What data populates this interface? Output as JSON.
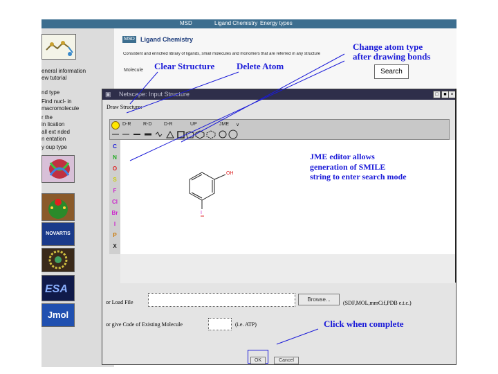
{
  "nav": {
    "msd": "MSD",
    "ligand": "Ligand Chemistry",
    "energy": "Energy types"
  },
  "sidebar": {
    "lines": [
      "eneral information",
      "ew tutorial",
      "nd type",
      "Find nucl- in",
      "macromolecule",
      "r the ",
      "in lication",
      "all ext nded",
      "n entation",
      "y oup type",
      "atom type"
    ],
    "logos": [
      "logo-molecule",
      "logo-ribbon",
      "logo-cactus",
      "logo-novartis",
      "logo-cluster",
      "logo-esa",
      "logo-jmol"
    ],
    "novartis_text": "NOVARTIS",
    "jmol_text": "Jmol"
  },
  "main": {
    "badge": "MSD",
    "title": "Ligand Chemistry",
    "description": "Consistent and enriched library of ligands, small molecules and monomers that are referred in any structure",
    "mol_label": "Molecule",
    "search_label": "Search"
  },
  "annotations": {
    "change_atom": "Change atom type",
    "after_bonds": "after drawing bonds",
    "clear_structure": "Clear Structure",
    "delete_atom": "Delete Atom",
    "jme_line1": "JME editor allows",
    "jme_line2": "generation of SMILE",
    "jme_line3": "string to enter search mode",
    "click_complete": "Click when complete"
  },
  "dialog": {
    "title": "Netscape: Input Structure",
    "draw_label": "Draw Structure:",
    "toolbar_row1": [
      "D-R",
      "R-D",
      "D-R",
      "UP",
      "JME"
    ],
    "atoms": [
      "C",
      "N",
      "O",
      "S",
      "F",
      "Cl",
      "Br",
      "I",
      "P",
      "X"
    ],
    "atom_colors": [
      "#1a1ad8",
      "#22aa22",
      "#dd2222",
      "#cccc00",
      "#cc22cc",
      "#cc22cc",
      "#cc22cc",
      "#cc22cc",
      "#cc7700",
      "#222222"
    ],
    "mol_oh": "OH",
    "mol_i": "I",
    "load_label": "or Load File",
    "browse": "Browse...",
    "formats": "(SDF,MOL,mmCif,PDB e.t.c.)",
    "code_label": "or give Code of Existing Molecule",
    "code_example": "(i.e. ATP)",
    "ok": "OK",
    "cancel": "Cancel"
  }
}
